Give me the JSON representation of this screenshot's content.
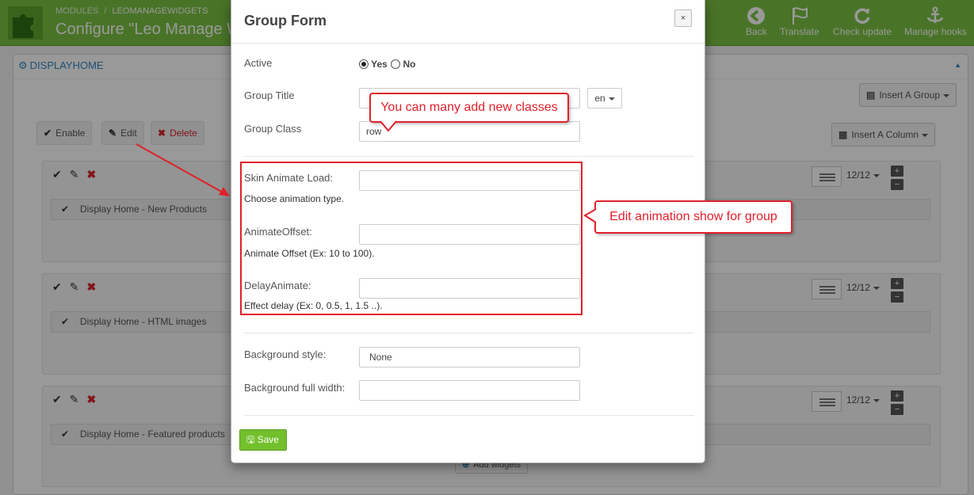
{
  "colors": {
    "brand": "#7ac143",
    "accent": "#3587c2",
    "annotation": "#e0202b",
    "save": "#72c02c"
  },
  "header": {
    "breadcrumb_modules": "MODULES",
    "breadcrumb_separator": "/",
    "breadcrumb_current": "LEOMANAGEWIDGETS",
    "title": "Configure \"Leo Manage W",
    "toolbar": [
      {
        "label": "Back",
        "icon": "back-arrow-icon"
      },
      {
        "label": "Translate",
        "icon": "flag-icon"
      },
      {
        "label": "Check update",
        "icon": "refresh-icon"
      },
      {
        "label": "Manage hooks",
        "icon": "anchor-icon"
      }
    ]
  },
  "panel": {
    "title": "DISPLAYHOME",
    "insert_group": "Insert A Group",
    "insert_column": "Insert A Column",
    "enable": "Enable",
    "edit": "Edit",
    "delete": "Delete",
    "add_widgets": "Add widgets",
    "groups": [
      {
        "widget": "Display Home - New Products",
        "size": "12/12"
      },
      {
        "widget": "Display Home - HTML images",
        "size": "12/12"
      },
      {
        "widget": "Display Home - Featured products",
        "size": "12/12"
      }
    ]
  },
  "modal": {
    "title": "Group Form",
    "close": "×",
    "active_label": "Active",
    "yes": "Yes",
    "no": "No",
    "active_value": "Yes",
    "group_title_label": "Group Title",
    "group_title_value": "",
    "lang": "en",
    "group_class_label": "Group Class",
    "group_class_value": "row",
    "skin_animate_label": "Skin Animate Load:",
    "skin_animate_help": "Choose animation type.",
    "animate_offset_label": "AnimateOffset:",
    "animate_offset_help": "Animate Offset (Ex: 10 to 100).",
    "delay_label": "DelayAnimate:",
    "delay_help": "Effect delay (Ex: 0, 0.5, 1, 1.5 ..).",
    "bg_style_label": "Background style:",
    "bg_style_value": "None",
    "bg_full_width_label": "Background full width:",
    "save": "Save"
  },
  "annotations": {
    "classes_note": "You can many add new classes",
    "animation_note": "Edit animation show for group"
  }
}
